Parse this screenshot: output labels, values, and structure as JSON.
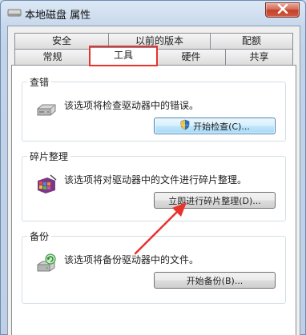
{
  "window": {
    "title": "本地磁盘 属性",
    "close_icon": "close-x-icon"
  },
  "tabs": {
    "row1": [
      "安全",
      "以前的版本",
      "配额"
    ],
    "row2": [
      "常规",
      "工具",
      "硬件",
      "共享"
    ],
    "active": "工具"
  },
  "groups": {
    "check": {
      "title": "查错",
      "description": "该选项将检查驱动器中的错误。",
      "button_label": "开始检查(C)...",
      "icon": "drive-icon"
    },
    "defrag": {
      "title": "碎片整理",
      "description": "该选项将对驱动器中的文件进行碎片整理。",
      "button_label": "立即进行碎片整理(D)...",
      "icon": "defrag-icon"
    },
    "backup": {
      "title": "备份",
      "description": "该选项将备份驱动器中的文件。",
      "button_label": "开始备份(B)...",
      "icon": "backup-icon"
    }
  },
  "annotation": {
    "color": "#e8322c"
  }
}
